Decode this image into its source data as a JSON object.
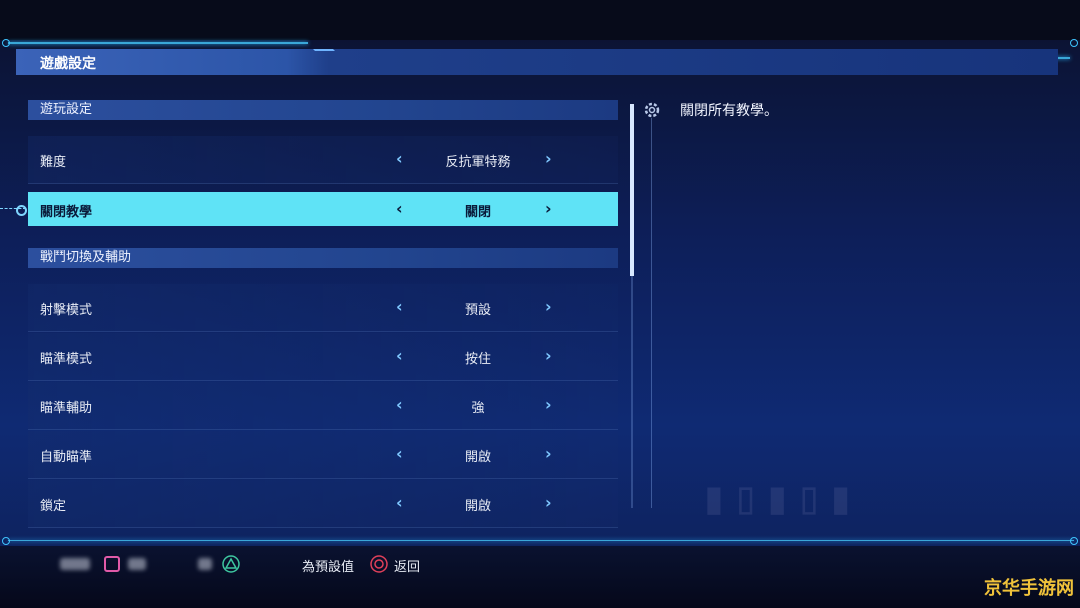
{
  "window": {
    "title": "遊戲設定"
  },
  "sections": [
    {
      "header": "遊玩設定",
      "rows": [
        {
          "label": "難度",
          "value": "反抗軍特務"
        },
        {
          "label": "關閉教學",
          "value": "關閉",
          "selected": true
        }
      ]
    },
    {
      "header": "戰鬥切換及輔助",
      "rows": [
        {
          "label": "射擊模式",
          "value": "預設"
        },
        {
          "label": "瞄準模式",
          "value": "按住"
        },
        {
          "label": "瞄準輔助",
          "value": "強"
        },
        {
          "label": "自動瞄準",
          "value": "開啟"
        },
        {
          "label": "鎖定",
          "value": "開啟"
        }
      ]
    }
  ],
  "arrows": {
    "left": "‹",
    "right": "›"
  },
  "description": {
    "icon": "gear-icon",
    "text": "關閉所有教學。"
  },
  "footer": {
    "reset_label": "為預設值",
    "back_label": "返回"
  },
  "watermark": "京华手游网",
  "colors": {
    "accent_cyan": "#5fe3f6",
    "frame_blue": "#3aa7d8",
    "square_pink": "#e05aa8",
    "triangle_green": "#3ec7a0",
    "circle_red": "#e0405a",
    "logo_gold": "#f0c23a"
  }
}
